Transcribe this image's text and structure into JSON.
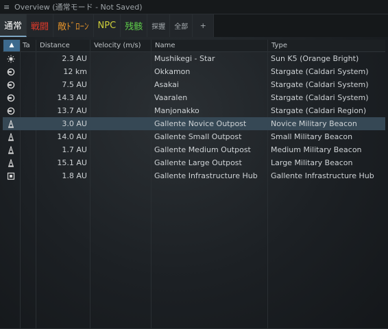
{
  "window": {
    "menu_icon": "hamburger-icon",
    "title": "Overview (通常モード - Not Saved)"
  },
  "tabs": [
    {
      "label": "通常",
      "color": "#ffffff",
      "active": true
    },
    {
      "label": "戦闘",
      "color": "#e23a2a"
    },
    {
      "label": "敵ﾄﾞﾛｰﾝ",
      "color": "#e0902a"
    },
    {
      "label": "NPC",
      "color": "#cfcf3a"
    },
    {
      "label": "残骸",
      "color": "#5fd04a"
    },
    {
      "label": "探握",
      "color": "#a7adb1",
      "small": true
    },
    {
      "label": "全部",
      "color": "#a7adb1",
      "small": true
    },
    {
      "label": "+",
      "color": "#a7adb1",
      "plus": true
    }
  ],
  "columns": {
    "sort_icon": "▲",
    "tag": "Ta",
    "distance": "Distance",
    "velocity": "Velocity (m/s)",
    "name": "Name",
    "type": "Type"
  },
  "rows": [
    {
      "icon": "sun-icon",
      "distance": "2.3 AU",
      "name": "Mushikegi - Star",
      "type": "Sun K5 (Orange Bright)"
    },
    {
      "icon": "stargate-icon",
      "distance": "12 km",
      "name": "Okkamon",
      "type": "Stargate (Caldari System)"
    },
    {
      "icon": "stargate-icon",
      "distance": "7.5 AU",
      "name": "Asakai",
      "type": "Stargate (Caldari System)"
    },
    {
      "icon": "stargate-icon",
      "distance": "14.3 AU",
      "name": "Vaaralen",
      "type": "Stargate (Caldari System)"
    },
    {
      "icon": "stargate-icon",
      "distance": "13.7 AU",
      "name": "Manjonakko",
      "type": "Stargate (Caldari Region)"
    },
    {
      "icon": "beacon-icon",
      "distance": "3.0 AU",
      "name": "Gallente Novice Outpost",
      "type": "Novice Military Beacon",
      "selected": true
    },
    {
      "icon": "beacon-icon",
      "distance": "14.0 AU",
      "name": "Gallente Small Outpost",
      "type": "Small Military Beacon"
    },
    {
      "icon": "beacon-icon",
      "distance": "1.7 AU",
      "name": "Gallente Medium Outpost",
      "type": "Medium Military Beacon"
    },
    {
      "icon": "beacon-icon",
      "distance": "15.1 AU",
      "name": "Gallente Large Outpost",
      "type": "Large Military Beacon"
    },
    {
      "icon": "infrastructure-hub-icon",
      "distance": "1.8 AU",
      "name": "Gallente Infrastructure Hub",
      "type": "Gallente Infrastructure Hub"
    }
  ]
}
